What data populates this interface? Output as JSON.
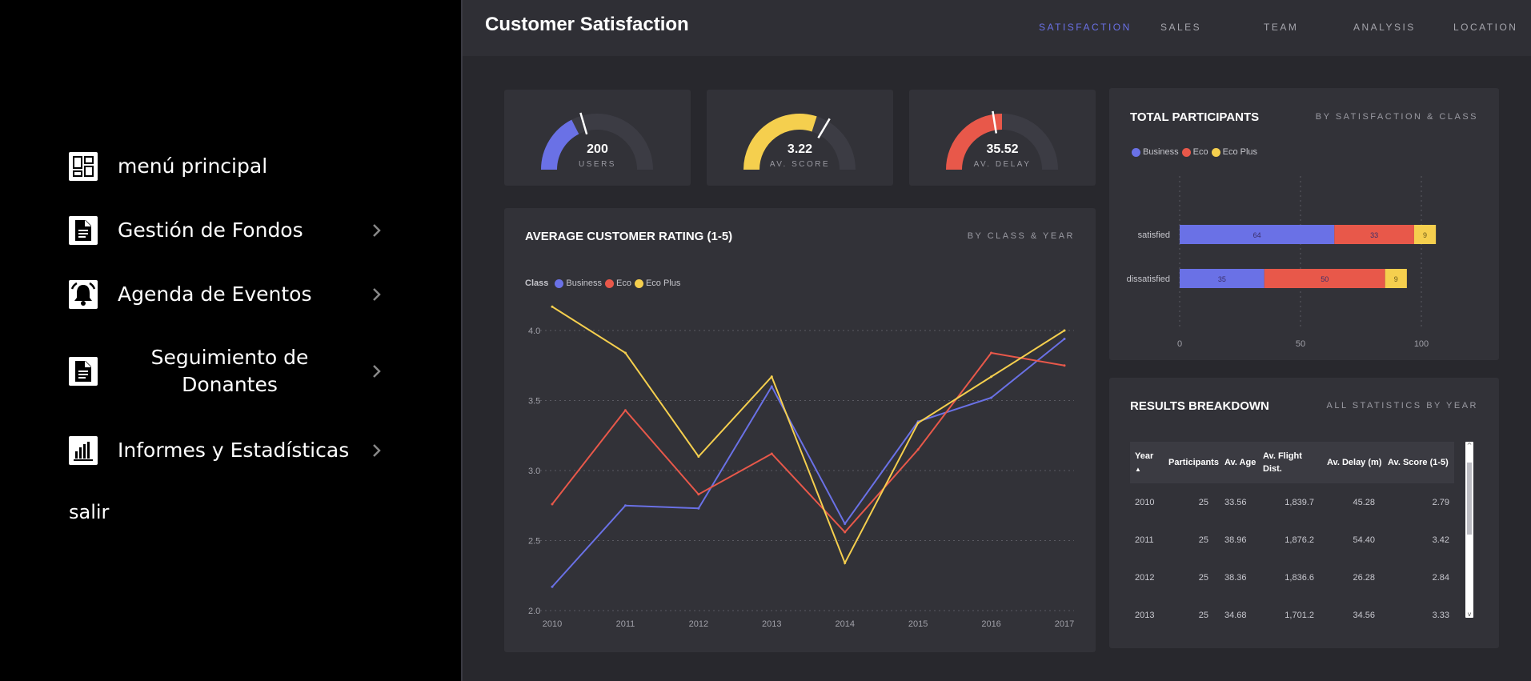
{
  "sidebar": {
    "items": [
      {
        "label": "menú principal",
        "icon": "dashboard-icon",
        "has_chevron": false
      },
      {
        "label": "Gestión de Fondos",
        "icon": "document-icon",
        "has_chevron": true
      },
      {
        "label": "Agenda de Eventos",
        "icon": "bell-icon",
        "has_chevron": true
      },
      {
        "label": "Seguimiento de Donantes",
        "icon": "document-icon",
        "has_chevron": true
      },
      {
        "label": "Informes y Estadísticas",
        "icon": "bar-chart-icon",
        "has_chevron": true
      }
    ],
    "logout_label": "salir"
  },
  "dashboard": {
    "title": "Customer Satisfaction",
    "tabs": [
      "SATISFACTION",
      "SALES",
      "TEAM",
      "ANALYSIS",
      "LOCATION"
    ],
    "active_tab": "SATISFACTION",
    "colors": {
      "business": "#6a71e6",
      "eco": "#e8584a",
      "eco_plus": "#f5cf4e",
      "track": "#3c3c44",
      "background": "#28282d",
      "card": "#323238"
    },
    "gauges": [
      {
        "value_text": "200",
        "label": "USERS",
        "color": "#6a71e6",
        "fill_fraction": 0.35,
        "target_fraction": 0.41
      },
      {
        "value_text": "3.22",
        "label": "AV. SCORE",
        "color": "#f5cf4e",
        "fill_fraction": 0.6,
        "target_fraction": 0.67
      },
      {
        "value_text": "35.52",
        "label": "AV. DELAY",
        "color": "#e8584a",
        "fill_fraction": 0.5,
        "target_fraction": 0.45
      }
    ],
    "participants": {
      "title": "TOTAL PARTICIPANTS",
      "subtitle": "BY SATISFACTION & CLASS",
      "legend": [
        "Business",
        "Eco",
        "Eco Plus"
      ]
    },
    "rating": {
      "title": "AVERAGE CUSTOMER RATING (1-5)",
      "subtitle": "BY CLASS & YEAR",
      "legend_title": "Class",
      "legend": [
        "Business",
        "Eco",
        "Eco Plus"
      ]
    },
    "results": {
      "title": "RESULTS BREAKDOWN",
      "subtitle": "ALL STATISTICS BY YEAR",
      "columns": [
        "Year",
        "Participants",
        "Av. Age",
        "Av. Flight Dist.",
        "Av. Delay (m)",
        "Av. Score (1-5)"
      ],
      "rows": [
        [
          "2010",
          "25",
          "33.56",
          "1,839.7",
          "45.28",
          "2.79"
        ],
        [
          "2011",
          "25",
          "38.96",
          "1,876.2",
          "54.40",
          "3.42"
        ],
        [
          "2012",
          "25",
          "38.36",
          "1,836.6",
          "26.28",
          "2.84"
        ],
        [
          "2013",
          "25",
          "34.68",
          "1,701.2",
          "34.56",
          "3.33"
        ]
      ],
      "sort_indicator": "▲"
    }
  },
  "chart_data": [
    {
      "type": "bar",
      "orientation": "horizontal",
      "stacked": true,
      "title": "TOTAL PARTICIPANTS",
      "subtitle": "BY SATISFACTION & CLASS",
      "categories": [
        "satisfied",
        "dissatisfied"
      ],
      "series": [
        {
          "name": "Business",
          "values": [
            64,
            35
          ]
        },
        {
          "name": "Eco",
          "values": [
            33,
            50
          ]
        },
        {
          "name": "Eco Plus",
          "values": [
            9,
            9
          ]
        }
      ],
      "xlim": [
        0,
        100
      ],
      "xticks": [
        "0",
        "50",
        "100"
      ],
      "grid": true,
      "legend": "top-left"
    },
    {
      "type": "line",
      "title": "AVERAGE CUSTOMER RATING (1-5)",
      "subtitle": "BY CLASS & YEAR",
      "x": [
        2010,
        2011,
        2012,
        2013,
        2014,
        2015,
        2016,
        2017
      ],
      "series": [
        {
          "name": "Business",
          "values": [
            2.17,
            2.75,
            2.73,
            3.6,
            2.62,
            3.35,
            3.52,
            3.94
          ]
        },
        {
          "name": "Eco",
          "values": [
            2.76,
            3.43,
            2.83,
            3.12,
            2.56,
            3.15,
            3.84,
            3.75
          ]
        },
        {
          "name": "Eco Plus",
          "values": [
            4.17,
            3.84,
            3.1,
            3.67,
            2.34,
            3.34,
            3.67,
            4.0
          ]
        }
      ],
      "ylim": [
        2.0,
        4.2
      ],
      "yticks": [
        "2.0",
        "2.5",
        "3.0",
        "3.5",
        "4.0"
      ],
      "xticks": [
        "2010",
        "2011",
        "2012",
        "2013",
        "2014",
        "2015",
        "2016",
        "2017"
      ],
      "grid": true,
      "legend": "top-left"
    }
  ]
}
